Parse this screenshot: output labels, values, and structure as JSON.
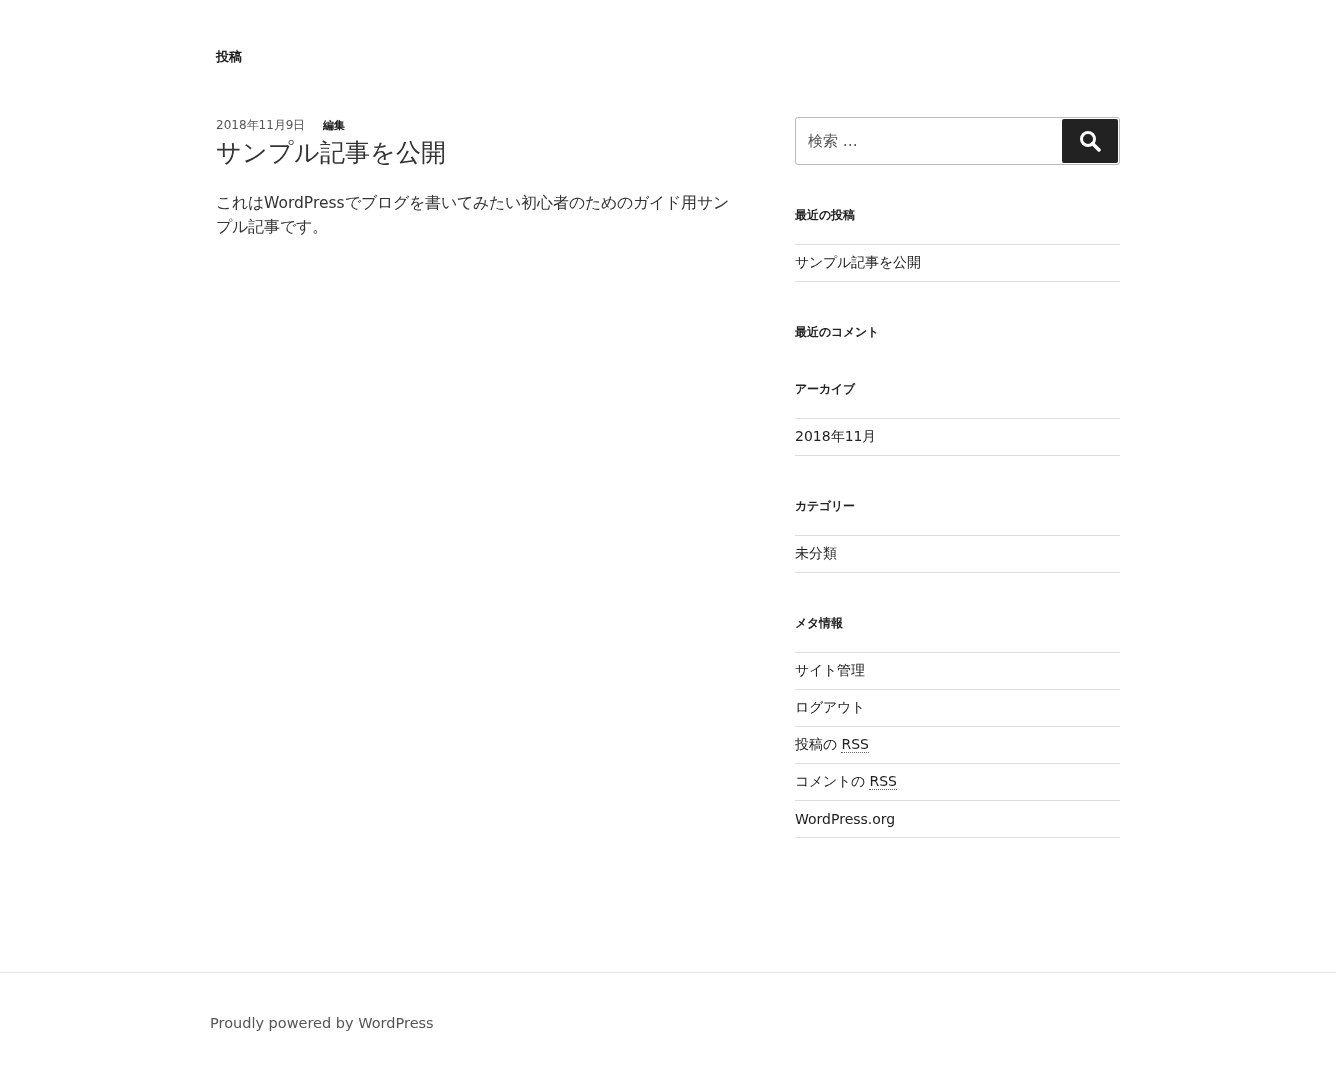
{
  "page_title": "投稿",
  "post": {
    "date": "2018年11月9日",
    "edit_link": "編集",
    "title": "サンプル記事を公開",
    "excerpt": "これはWordPressでブログを書いてみたい初心者のためのガイド用サンプル記事です。"
  },
  "search": {
    "placeholder": "検索 …"
  },
  "widgets": [
    {
      "title": "最近の投稿",
      "items": [
        {
          "label": "サンプル記事を公開"
        }
      ]
    },
    {
      "title": "最近のコメント"
    },
    {
      "title": "アーカイブ",
      "items": [
        {
          "label": "2018年11月"
        }
      ]
    },
    {
      "title": "カテゴリー",
      "items": [
        {
          "label": "未分類"
        }
      ]
    },
    {
      "title": "メタ情報",
      "items": [
        {
          "label": "サイト管理"
        },
        {
          "label": "ログアウト"
        },
        {
          "label": "投稿の ",
          "abbr": "RSS"
        },
        {
          "label": "コメントの ",
          "abbr": "RSS"
        },
        {
          "label": "WordPress.org"
        }
      ]
    }
  ],
  "footer": {
    "credit": "Proudly powered by WordPress"
  }
}
